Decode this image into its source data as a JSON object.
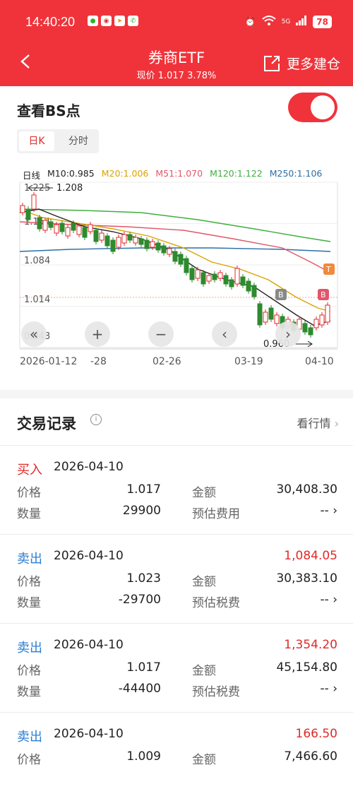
{
  "status": {
    "time": "14:40:20",
    "signal": "5G",
    "battery": "78"
  },
  "header": {
    "title": "券商ETF",
    "subtitle": "现价 1.017 3.78%",
    "more_label": "更多建仓"
  },
  "bs": {
    "title": "查看BS点",
    "tabs": [
      "日K",
      "分时"
    ]
  },
  "legend": [
    {
      "label": "日线",
      "color": "#222222"
    },
    {
      "label": "M10:0.985",
      "color": "#222222"
    },
    {
      "label": "M20:1.006",
      "color": "#d9a300"
    },
    {
      "label": "M51:1.070",
      "color": "#e0566a"
    },
    {
      "label": "M120:1.122",
      "color": "#3fae3f"
    },
    {
      "label": "M250:1.106",
      "color": "#2b6fa6"
    }
  ],
  "chart_data": {
    "type": "candlestick",
    "y_ticks": [
      "1.225",
      "1.154",
      "1.084",
      "1.014",
      "0.943"
    ],
    "annotations": {
      "high": "1.208",
      "low": "0.960"
    },
    "x_labels": [
      "2026-01-12",
      "-28",
      "02-26",
      "03-19",
      "04-10"
    ],
    "markers": [
      "B",
      "B",
      "T"
    ],
    "controls": [
      "«",
      "+",
      "−",
      "‹",
      "›"
    ]
  },
  "records": {
    "title": "交易记录",
    "view_label": "看行情",
    "items": [
      {
        "type": "买入",
        "date": "2026-04-10",
        "amount": "",
        "price": "1.017",
        "total": "30,408.30",
        "qty": "29900",
        "fee_label": "预估费用",
        "fee": "--"
      },
      {
        "type": "卖出",
        "date": "2026-04-10",
        "amount": "1,084.05",
        "price": "1.023",
        "total": "30,383.10",
        "qty": "-29700",
        "fee_label": "预估税费",
        "fee": "--"
      },
      {
        "type": "卖出",
        "date": "2026-04-10",
        "amount": "1,354.20",
        "price": "1.017",
        "total": "45,154.80",
        "qty": "-44400",
        "fee_label": "预估税费",
        "fee": "--"
      },
      {
        "type": "卖出",
        "date": "2026-04-10",
        "amount": "166.50",
        "price": "1.009",
        "total": "7,466.60",
        "qty": "",
        "fee_label": "",
        "fee": ""
      }
    ],
    "labels": {
      "price": "价格",
      "total": "金额",
      "qty": "数量"
    }
  },
  "colors": {
    "accent": "#f0333a",
    "buy": "#e02a2a",
    "sell": "#2b7fd4"
  }
}
